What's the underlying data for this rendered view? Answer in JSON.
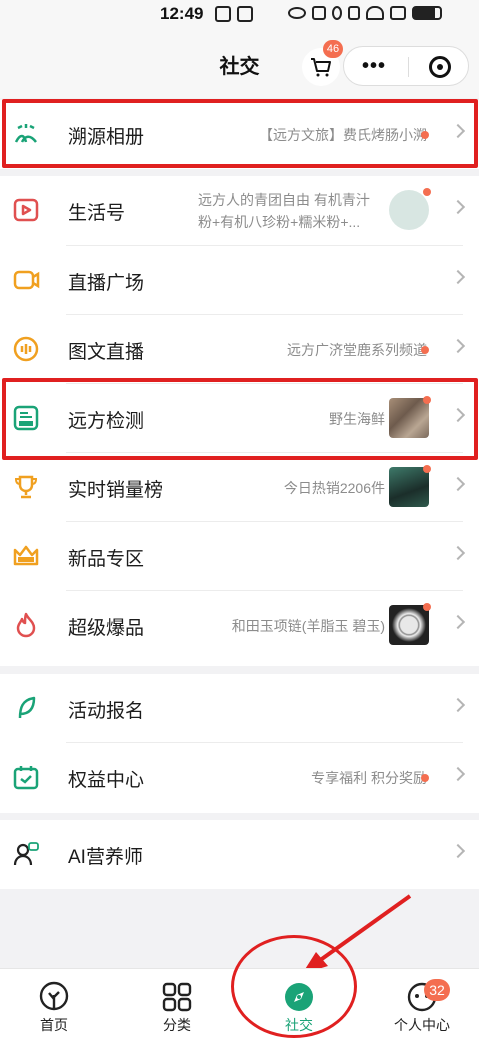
{
  "status_bar": {
    "time": "12:49"
  },
  "header": {
    "title": "社交",
    "cart_badge": "46"
  },
  "menu": [
    {
      "label": "溯源相册",
      "sub": "【远方文旅】费氏烤肠小溯",
      "icon": "scenery-icon"
    },
    {
      "label": "生活号",
      "sub": "远方人的青团自由 有机青汁粉+有机八珍粉+糯米粉+...",
      "icon": "play-icon"
    },
    {
      "label": "直播广场",
      "sub": "",
      "icon": "camera-icon"
    },
    {
      "label": "图文直播",
      "sub": "远方广济堂鹿系列频道",
      "icon": "audio-icon"
    },
    {
      "label": "远方检测",
      "sub": "野生海鲜",
      "icon": "inspection-icon"
    },
    {
      "label": "实时销量榜",
      "sub": "今日热销2206件",
      "icon": "trophy-icon"
    },
    {
      "label": "新品专区",
      "sub": "",
      "icon": "new-crown-icon"
    },
    {
      "label": "超级爆品",
      "sub": "和田玉项链(羊脂玉 碧玉)",
      "icon": "fire-icon"
    },
    {
      "label": "活动报名",
      "sub": "",
      "icon": "leaf-icon"
    },
    {
      "label": "权益中心",
      "sub": "专享福利 积分奖励",
      "icon": "calendar-icon"
    },
    {
      "label": "AI营养师",
      "sub": "",
      "icon": "ai-person-icon"
    }
  ],
  "bottom_nav": [
    {
      "label": "首页"
    },
    {
      "label": "分类"
    },
    {
      "label": "社交"
    },
    {
      "label": "个人中心",
      "badge": "32"
    }
  ],
  "colors": {
    "brand_green": "#1aa377",
    "badge_red": "#f46e50",
    "annotation_red": "#e02020"
  }
}
